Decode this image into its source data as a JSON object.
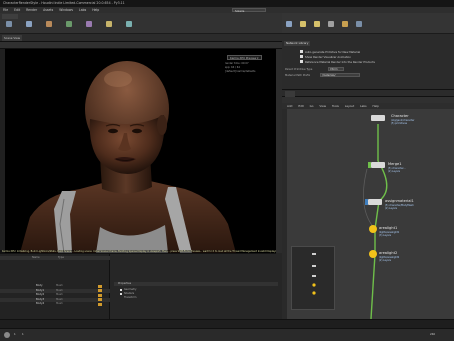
{
  "window": {
    "title": "CharacterRenderStyle - Houdini Indie Limited-Commercial 20.0.654 - Py3.11"
  },
  "menubar": {
    "items": [
      "File",
      "Edit",
      "Render",
      "Assets",
      "Windows",
      "Labs",
      "Help"
    ],
    "desktop": "Solaris"
  },
  "viewport": {
    "tab": "Scene View",
    "camera_button": "Karma XPU Preview ▾",
    "camera_stats": [
      "render time: 00:07",
      "spp: 64 / 64",
      "[default] karma/defaults"
    ],
    "status": "Karma XPU: Initializing, Build Lightlinks/Stats, Build Scene... Loading scene: Initial Scene Chains, Building Sparse Display in viewport, then... press Shift-Fx to Preview... wait for it to load all the Thread Management  Invalid Displays"
  },
  "params": {
    "header": "Network Library",
    "rows": [
      "Auto-generate Primitive for New Material",
      "Show Render Visualizer Animation",
      "Reference Material Render Into the Render Products"
    ],
    "label1": "Parent Primitive Type",
    "field1": "Xform",
    "label2": "Material Path Prefix",
    "field2": "/materials/"
  },
  "network": {
    "menu": [
      "Add",
      "Edit",
      "Go",
      "View",
      "Tools",
      "Layout",
      "Labs",
      "Help"
    ],
    "nodes": [
      {
        "name": "Character",
        "sub": [
          "/obj/geo1/character",
          "(5) primitives"
        ]
      },
      {
        "name": "Merge1",
        "sub": [
          "(5) character...",
          "(2) Layers"
        ]
      },
      {
        "name": "assignmaterial1",
        "sub": [
          "(5) character/BodyMesh",
          "(2) Layers"
        ]
      },
      {
        "name": "arealight1",
        "sub": [
          "/lights/arealight1",
          "(3) Layers"
        ]
      },
      {
        "name": "arealight2",
        "sub": [
          "/lights/arealight2",
          "(2) Layers"
        ]
      }
    ]
  },
  "table": {
    "header": [
      "Name",
      "Type"
    ],
    "rows": [
      [
        "Body",
        "Mesh"
      ],
      [
        "Body1",
        "Mesh"
      ],
      [
        "Body2",
        "Mesh"
      ],
      [
        "Body3",
        "Mesh"
      ],
      [
        "Body4",
        "Mesh"
      ]
    ]
  },
  "props": {
    "header": "Properties",
    "rows": [
      "Geometry",
      "Shaders",
      "Transform"
    ]
  },
  "timeline": {
    "start": "1",
    "end": "240",
    "current_frame": "1"
  },
  "colors": {
    "accent": "#ffaa33",
    "node_lop": "#5b9ee6",
    "wire": "#6fbf4a",
    "light": "#f2c21a"
  }
}
